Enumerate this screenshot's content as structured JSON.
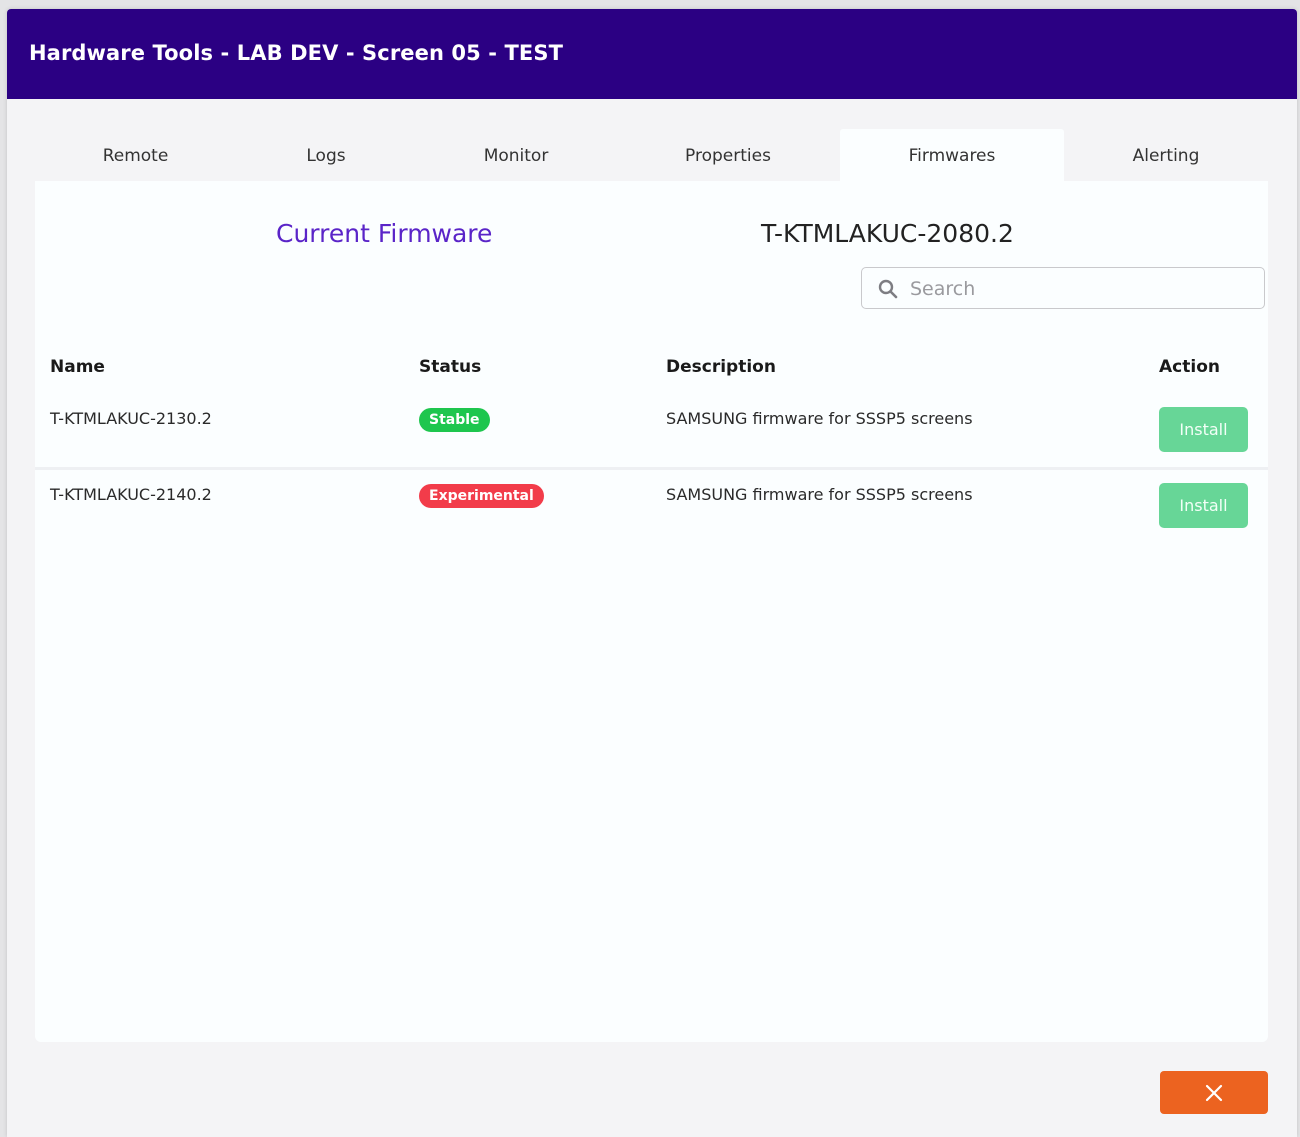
{
  "window": {
    "title": "Hardware Tools - LAB DEV - Screen 05 - TEST"
  },
  "tabs": [
    {
      "label": "Remote",
      "active": false
    },
    {
      "label": "Logs",
      "active": false
    },
    {
      "label": "Monitor",
      "active": false
    },
    {
      "label": "Properties",
      "active": false
    },
    {
      "label": "Firmwares",
      "active": true
    },
    {
      "label": "Alerting",
      "active": false
    }
  ],
  "current_firmware": {
    "label": "Current Firmware",
    "value": "T-KTMLAKUC-2080.2"
  },
  "search": {
    "placeholder": "Search",
    "value": "",
    "icon": "search-icon"
  },
  "table": {
    "columns": [
      "Name",
      "Status",
      "Description",
      "Action"
    ],
    "rows": [
      {
        "name": "T-KTMLAKUC-2130.2",
        "status": "Stable",
        "description": "SAMSUNG firmware for SSSP5 screens",
        "action": "Install"
      },
      {
        "name": "T-KTMLAKUC-2140.2",
        "status": "Experimental",
        "description": "SAMSUNG firmware for SSSP5 screens",
        "action": "Install"
      }
    ]
  },
  "footer": {
    "close_icon": "close-icon"
  },
  "colors": {
    "header_bg": "#2b0083",
    "accent_purple": "#5a24c8",
    "stable_badge": "#1ec64e",
    "experimental_badge": "#f23c4a",
    "install_button": "#67d697",
    "close_button": "#ec6320"
  }
}
